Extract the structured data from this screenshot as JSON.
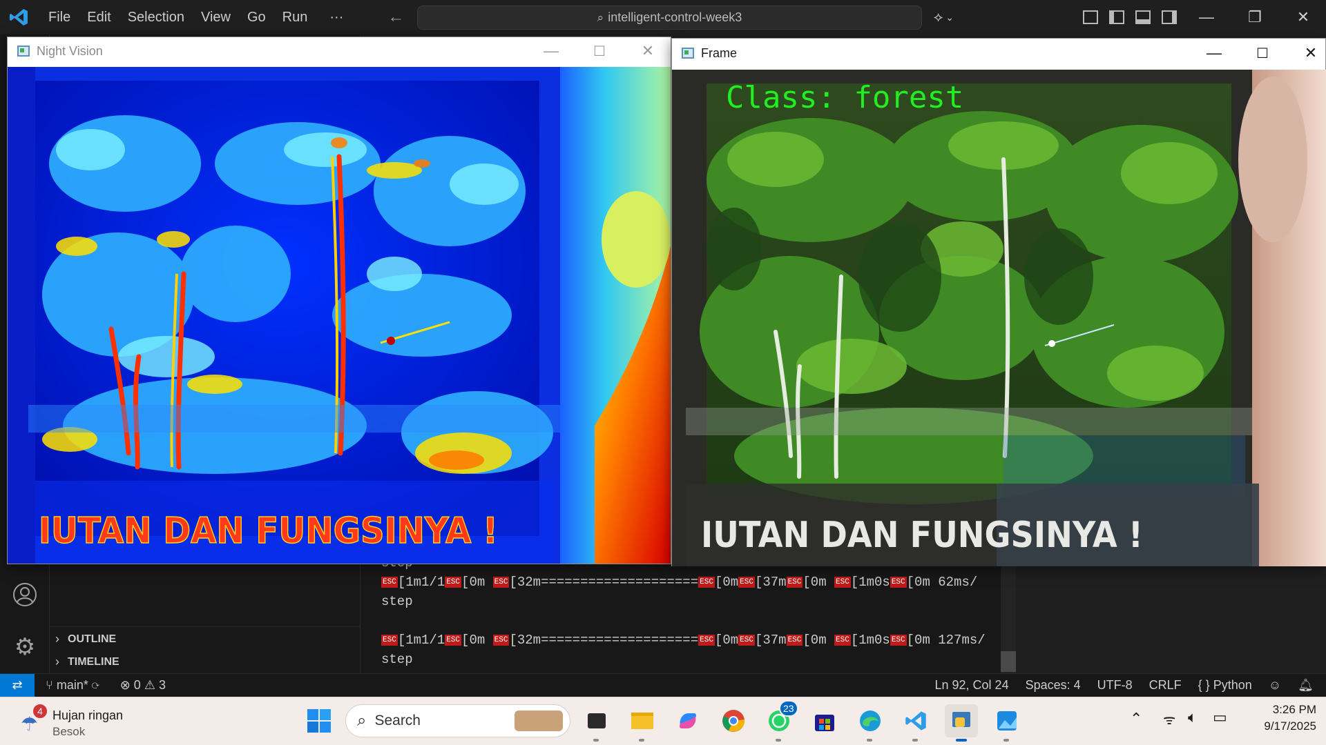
{
  "titlebar": {
    "menu": [
      "File",
      "Edit",
      "Selection",
      "View",
      "Go",
      "Run",
      "···"
    ],
    "search_text": "intelligent-control-week3"
  },
  "night_window": {
    "title": "Night Vision",
    "caption": "IUTAN DAN FUNGSINYA !"
  },
  "frame_window": {
    "title": "Frame",
    "class_label": "Class:  forest",
    "caption": "IUTAN DAN FUNGSINYA !"
  },
  "terminal": {
    "lines": [
      {
        "kind": "text",
        "text": "step"
      },
      {
        "kind": "progress",
        "p1": "[1m1/1",
        "p2": "[0m ",
        "p3": "[32m====================",
        "p4": "[0m",
        "p5": "[37m",
        "p6": "[0m ",
        "p7": "[1m0s",
        "p8": "[0m 62ms/"
      },
      {
        "kind": "text",
        "text": "step"
      },
      {
        "kind": "text",
        "text": ""
      },
      {
        "kind": "progress",
        "p1": "[1m1/1",
        "p2": "[0m ",
        "p3": "[32m====================",
        "p4": "[0m",
        "p5": "[37m",
        "p6": "[0m ",
        "p7": "[1m0s",
        "p8": "[0m 127ms/"
      },
      {
        "kind": "text",
        "text": "step"
      }
    ],
    "esc_label": "ESC"
  },
  "sidebar": {
    "outline": "OUTLINE",
    "timeline": "TIMELINE"
  },
  "statusbar": {
    "branch": "main*",
    "errors": "0",
    "warnings": "3",
    "position": "Ln 92, Col 24",
    "spaces": "Spaces: 4",
    "encoding": "UTF-8",
    "eol": "CRLF",
    "language": "Python"
  },
  "taskbar": {
    "weather_title": "Hujan ringan",
    "weather_sub": "Besok",
    "weather_badge": "4",
    "search_placeholder": "Search",
    "whatsapp_badge": "23",
    "time": "3:26 PM",
    "date": "9/17/2025"
  },
  "colors": {
    "accent": "#0078d4",
    "class_label": "#22ee22",
    "caption_night": "#ff3a1a"
  }
}
